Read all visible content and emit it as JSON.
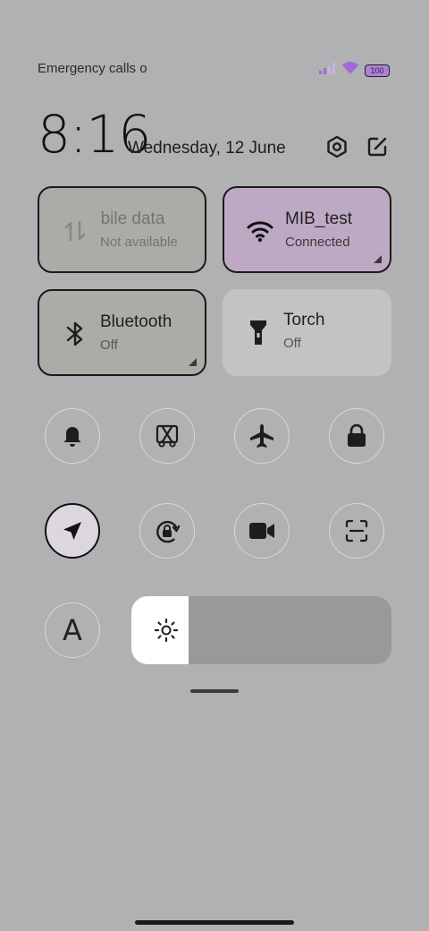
{
  "status_bar": {
    "carrier_text": "Emergency calls o",
    "battery_level": "100",
    "signal_icon": "signal-icon",
    "wifi_icon": "wifi-icon"
  },
  "header": {
    "time": "8:16",
    "date": "Wednesday, 12 June"
  },
  "tiles": {
    "mobile_data": {
      "title": "obile data",
      "subtitle": "Not available"
    },
    "wifi": {
      "title": "MIB_test",
      "subtitle": "Connected"
    },
    "bluetooth": {
      "title": "Bluetooth",
      "subtitle": "Off"
    },
    "torch": {
      "title": "Torch",
      "subtitle": "Off"
    }
  },
  "toggles_row1": [
    "bell-icon",
    "screenshot-icon",
    "airplane-icon",
    "lock-icon"
  ],
  "toggles_row2": [
    "location-icon",
    "rotation-lock-icon",
    "video-icon",
    "scan-icon"
  ],
  "font_button_label": "A",
  "brightness": {
    "level": 0.22
  },
  "colors": {
    "background": "#b1b0b3",
    "wifi_tile": "#bea9c4",
    "battery_fill": "#b07fdc",
    "signal_accent": "#a06ad6"
  }
}
